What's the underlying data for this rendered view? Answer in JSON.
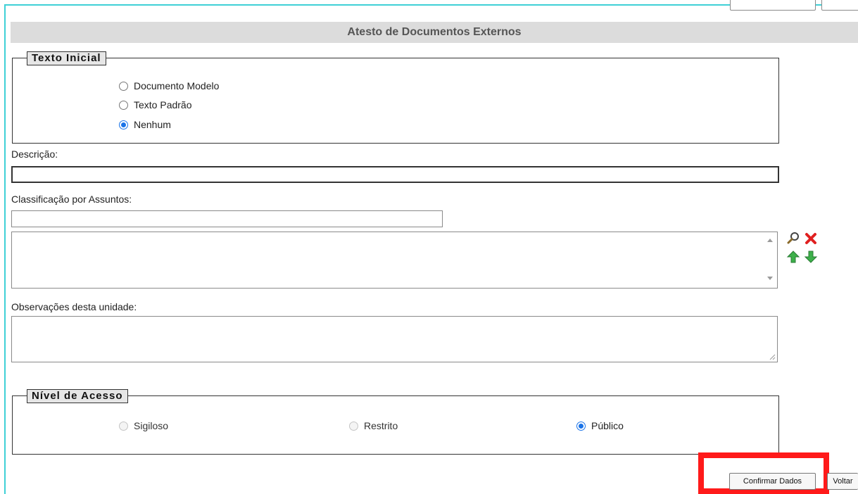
{
  "page": {
    "title": "Atesto de Documentos Externos"
  },
  "texto_inicial": {
    "legend": "Texto Inicial",
    "options": [
      {
        "label": "Documento Modelo",
        "checked": false
      },
      {
        "label": "Texto Padrão",
        "checked": false
      },
      {
        "label": "Nenhum",
        "checked": true
      }
    ]
  },
  "descricao": {
    "label": "Descrição:",
    "value": ""
  },
  "classificacao": {
    "label": "Classificação por Assuntos:",
    "search_value": "",
    "list_value": "",
    "icons": [
      "magnifier-icon",
      "remove-x-icon",
      "move-up-arrow-icon",
      "move-down-arrow-icon"
    ]
  },
  "observacoes": {
    "label": "Observações desta unidade:",
    "value": ""
  },
  "nivel_acesso": {
    "legend": "Nível de Acesso",
    "options": [
      {
        "label": "Sigiloso",
        "checked": false,
        "disabled": true
      },
      {
        "label": "Restrito",
        "checked": false,
        "disabled": true
      },
      {
        "label": "Público",
        "checked": true,
        "disabled": false
      }
    ]
  },
  "buttons": {
    "confirm": "Confirmar Dados",
    "back": "Voltar"
  },
  "colors": {
    "highlight": "#ff1a1a",
    "frame": "#3fd0d6",
    "radio_checked": "#1a73e8",
    "up_arrow": "#3db04a",
    "remove_x": "#e02020"
  }
}
